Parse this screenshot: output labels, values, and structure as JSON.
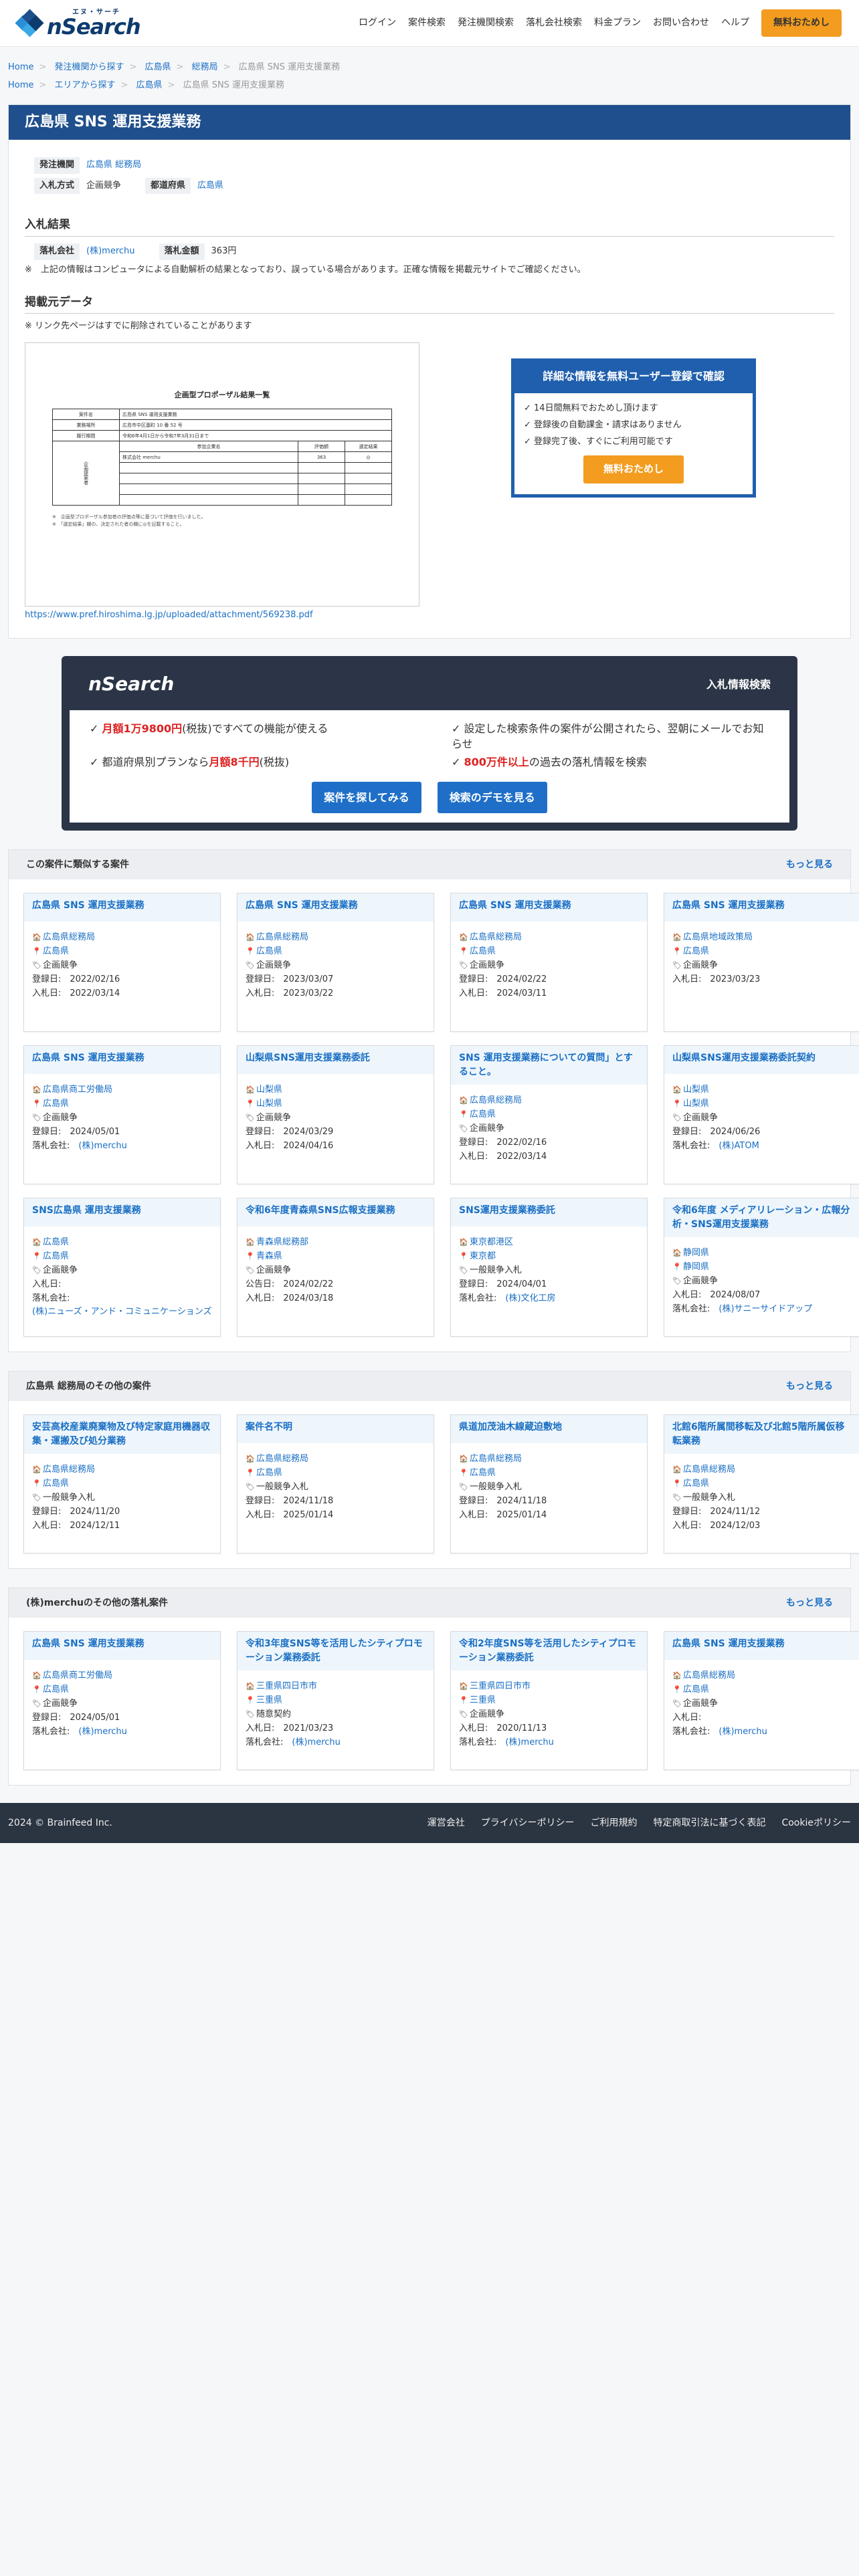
{
  "header": {
    "logo_ruby": "エヌ・サーチ",
    "logo_text": "nSearch",
    "nav": [
      "ログイン",
      "案件検索",
      "発注機関検索",
      "落札会社検索",
      "料金プラン",
      "お問い合わせ",
      "ヘルプ"
    ],
    "cta": "無料おためし"
  },
  "breadcrumb1": [
    "Home",
    "発注機関から探す",
    "広島県",
    "総務局",
    "広島県 SNS 運用支援業務"
  ],
  "breadcrumb2": [
    "Home",
    "エリアから探す",
    "広島県",
    "広島県 SNS 運用支援業務"
  ],
  "title": "広島県 SNS 運用支援業務",
  "meta": {
    "issuer_label": "発注機関",
    "issuer": "広島県 総務局",
    "pref_label": "都道府県",
    "pref": "広島県",
    "method_label": "入札方式",
    "method": "企画競争"
  },
  "result": {
    "heading": "入札結果",
    "winner_label": "落札会社",
    "winner": "(株)merchu",
    "amount_label": "落札金額",
    "amount": "363円",
    "note": "※　上記の情報はコンピュータによる自動解析の結果となっており、誤っている場合があります。正確な情報を掲載元サイトでご確認ください。"
  },
  "source": {
    "heading": "掲載元データ",
    "note": "※ リンク先ページはすでに削除されていることがあります",
    "url": "https://www.pref.hiroshima.lg.jp/uploaded/attachment/569238.pdf",
    "doc": {
      "title": "企画型プロポーザル結果一覧",
      "r1a": "案件名",
      "r1b": "広島県 SNS 運用支援業務",
      "r2a": "業務場所",
      "r2b": "広島市中区基町 10 番 52 号",
      "r3a": "履行期間",
      "r3b": "令和6年4月1日から令和7年3月31日まで",
      "h1": "参加企業名",
      "h2": "評価額",
      "h3": "選定結果",
      "c1": "株式会社 merchu",
      "c2": "363",
      "c3": "◎",
      "side": "企画提案者",
      "f1": "※　企画型プロポーザル参加者の評価点等に基づいて評価を行いました。",
      "f2": "※　「選定結果」欄の、決定された者の欄に◎を記載すること。"
    }
  },
  "cta_box": {
    "title": "詳細な情報を無料ユーザー登録で確認",
    "items": [
      "✓ 14日間無料でおためし頂けます",
      "✓ 登録後の自動課金・請求はありません",
      "✓ 登録完了後、すぐにご利用可能です"
    ],
    "button": "無料おためし"
  },
  "promo": {
    "logo": "nSearch",
    "title": "入札情報検索",
    "items": [
      {
        "pre": "✓ ",
        "red": "月額1万9800円",
        "post": "(税抜)ですべての機能が使える"
      },
      {
        "pre": "✓ 設定した検索条件の案件が公開されたら、翌朝にメールでお知らせ",
        "red": "",
        "post": ""
      },
      {
        "pre": "✓ 都道府県別プランなら",
        "red": "月額8千円",
        "post": "(税抜)"
      },
      {
        "pre": "✓ ",
        "red": "800万件以上",
        "post": "の過去の落札情報を検索"
      }
    ],
    "btn1": "案件を探してみる",
    "btn2": "検索のデモを見る"
  },
  "sections": [
    {
      "title": "この案件に類似する案件",
      "more": "もっと見る",
      "cards": [
        {
          "t": "広島県 SNS 運用支援業務",
          "lines": [
            [
              "🏠",
              "広島県総務局",
              1
            ],
            [
              "📍",
              "広島県",
              1
            ],
            [
              "🏷",
              "企画競争",
              0
            ],
            [
              "",
              "登録日:　2022/02/16",
              0
            ],
            [
              "",
              "入札日:　2022/03/14",
              0
            ]
          ]
        },
        {
          "t": "広島県 SNS 運用支援業務",
          "lines": [
            [
              "🏠",
              "広島県総務局",
              1
            ],
            [
              "📍",
              "広島県",
              1
            ],
            [
              "🏷",
              "企画競争",
              0
            ],
            [
              "",
              "登録日:　2023/03/07",
              0
            ],
            [
              "",
              "入札日:　2023/03/22",
              0
            ]
          ]
        },
        {
          "t": "広島県 SNS 運用支援業務",
          "lines": [
            [
              "🏠",
              "広島県総務局",
              1
            ],
            [
              "📍",
              "広島県",
              1
            ],
            [
              "🏷",
              "企画競争",
              0
            ],
            [
              "",
              "登録日:　2024/02/22",
              0
            ],
            [
              "",
              "入札日:　2024/03/11",
              0
            ]
          ]
        },
        {
          "t": "広島県 SNS 運用支援業務",
          "lines": [
            [
              "🏠",
              "広島県地域政策局",
              1
            ],
            [
              "📍",
              "広島県",
              1
            ],
            [
              "🏷",
              "企画競争",
              0
            ],
            [
              "",
              "入札日:　2023/03/23",
              0
            ]
          ]
        },
        {
          "t": "広島県 SNS 運用支援業務",
          "lines": [
            [
              "🏠",
              "広島県商工労働局",
              1
            ],
            [
              "📍",
              "広島県",
              1
            ],
            [
              "🏷",
              "企画競争",
              0
            ],
            [
              "",
              "登録日:　2024/05/01",
              0
            ],
            [
              "",
              "落札会社:　(株)merchu",
              2
            ]
          ]
        },
        {
          "t": "山梨県SNS運用支援業務委託",
          "lines": [
            [
              "🏠",
              "山梨県",
              1
            ],
            [
              "📍",
              "山梨県",
              1
            ],
            [
              "🏷",
              "企画競争",
              0
            ],
            [
              "",
              "登録日:　2024/03/29",
              0
            ],
            [
              "",
              "入札日:　2024/04/16",
              0
            ]
          ]
        },
        {
          "t": "SNS 運用支援業務についての質問」とすること。",
          "lines": [
            [
              "🏠",
              "広島県総務局",
              1
            ],
            [
              "📍",
              "広島県",
              1
            ],
            [
              "🏷",
              "企画競争",
              0
            ],
            [
              "",
              "登録日:　2022/02/16",
              0
            ],
            [
              "",
              "入札日:　2022/03/14",
              0
            ]
          ]
        },
        {
          "t": "山梨県SNS運用支援業務委託契約",
          "lines": [
            [
              "🏠",
              "山梨県",
              1
            ],
            [
              "📍",
              "山梨県",
              1
            ],
            [
              "🏷",
              "企画競争",
              0
            ],
            [
              "",
              "登録日:　2024/06/26",
              0
            ],
            [
              "",
              "落札会社:　(株)ATOM",
              2
            ]
          ]
        },
        {
          "t": "SNS広島県 運用支援業務",
          "lines": [
            [
              "🏠",
              "広島県",
              1
            ],
            [
              "📍",
              "広島県",
              1
            ],
            [
              "🏷",
              "企画競争",
              0
            ],
            [
              "",
              "入札日:",
              0
            ],
            [
              "",
              "落札会社:",
              0
            ],
            [
              "",
              "(株)ニューズ・アンド・コミュニケーションズ",
              1
            ]
          ]
        },
        {
          "t": "令和6年度青森県SNS広報支援業務",
          "lines": [
            [
              "🏠",
              "青森県総務部",
              1
            ],
            [
              "📍",
              "青森県",
              1
            ],
            [
              "🏷",
              "企画競争",
              0
            ],
            [
              "",
              "公告日:　2024/02/22",
              0
            ],
            [
              "",
              "入札日:　2024/03/18",
              0
            ]
          ]
        },
        {
          "t": "SNS運用支援業務委託",
          "lines": [
            [
              "🏠",
              "東京都港区",
              1
            ],
            [
              "📍",
              "東京都",
              1
            ],
            [
              "🏷",
              "一般競争入札",
              0
            ],
            [
              "",
              "登録日:　2024/04/01",
              0
            ],
            [
              "",
              "落札会社:　(株)文化工房",
              2
            ]
          ]
        },
        {
          "t": "令和6年度 メディアリレーション・広報分析・SNS運用支援業務",
          "lines": [
            [
              "🏠",
              "静岡県",
              1
            ],
            [
              "📍",
              "静岡県",
              1
            ],
            [
              "🏷",
              "企画競争",
              0
            ],
            [
              "",
              "入札日:　2024/08/07",
              0
            ],
            [
              "",
              "落札会社:　(株)サニーサイドアップ",
              2
            ]
          ]
        }
      ]
    },
    {
      "title": "広島県 総務局のその他の案件",
      "more": "もっと見る",
      "cards": [
        {
          "t": "安芸高校産業廃棄物及び特定家庭用機器収集・運搬及び処分業務",
          "lines": [
            [
              "🏠",
              "広島県総務局",
              1
            ],
            [
              "📍",
              "広島県",
              1
            ],
            [
              "🏷",
              "一般競争入札",
              0
            ],
            [
              "",
              "登録日:　2024/11/20",
              0
            ],
            [
              "",
              "入札日:　2024/12/11",
              0
            ]
          ]
        },
        {
          "t": "案件名不明",
          "lines": [
            [
              "🏠",
              "広島県総務局",
              1
            ],
            [
              "📍",
              "広島県",
              1
            ],
            [
              "🏷",
              "一般競争入札",
              0
            ],
            [
              "",
              "登録日:　2024/11/18",
              0
            ],
            [
              "",
              "入札日:　2025/01/14",
              0
            ]
          ]
        },
        {
          "t": "県道加茂油木線蔵迫敷地",
          "lines": [
            [
              "🏠",
              "広島県総務局",
              1
            ],
            [
              "📍",
              "広島県",
              1
            ],
            [
              "🏷",
              "一般競争入札",
              0
            ],
            [
              "",
              "登録日:　2024/11/18",
              0
            ],
            [
              "",
              "入札日:　2025/01/14",
              0
            ]
          ]
        },
        {
          "t": "北館6階所属間移転及び北館5階所属仮移転業務",
          "lines": [
            [
              "🏠",
              "広島県総務局",
              1
            ],
            [
              "📍",
              "広島県",
              1
            ],
            [
              "🏷",
              "一般競争入札",
              0
            ],
            [
              "",
              "登録日:　2024/11/12",
              0
            ],
            [
              "",
              "入札日:　2024/12/03",
              0
            ]
          ]
        }
      ]
    },
    {
      "title": "(株)merchuのその他の落札案件",
      "more": "もっと見る",
      "cards": [
        {
          "t": "広島県 SNS 運用支援業務",
          "lines": [
            [
              "🏠",
              "広島県商工労働局",
              1
            ],
            [
              "📍",
              "広島県",
              1
            ],
            [
              "🏷",
              "企画競争",
              0
            ],
            [
              "",
              "登録日:　2024/05/01",
              0
            ],
            [
              "",
              "落札会社:　(株)merchu",
              2
            ]
          ]
        },
        {
          "t": "令和3年度SNS等を活用したシティプロモーション業務委託",
          "lines": [
            [
              "🏠",
              "三重県四日市市",
              1
            ],
            [
              "📍",
              "三重県",
              1
            ],
            [
              "🏷",
              "随意契約",
              0
            ],
            [
              "",
              "入札日:　2021/03/23",
              0
            ],
            [
              "",
              "落札会社:　(株)merchu",
              2
            ]
          ]
        },
        {
          "t": "令和2年度SNS等を活用したシティプロモーション業務委託",
          "lines": [
            [
              "🏠",
              "三重県四日市市",
              1
            ],
            [
              "📍",
              "三重県",
              1
            ],
            [
              "🏷",
              "企画競争",
              0
            ],
            [
              "",
              "入札日:　2020/11/13",
              0
            ],
            [
              "",
              "落札会社:　(株)merchu",
              2
            ]
          ]
        },
        {
          "t": "広島県 SNS 運用支援業務",
          "lines": [
            [
              "🏠",
              "広島県総務局",
              1
            ],
            [
              "📍",
              "広島県",
              1
            ],
            [
              "🏷",
              "企画競争",
              0
            ],
            [
              "",
              "入札日:",
              0
            ],
            [
              "",
              "落札会社:　(株)merchu",
              2
            ]
          ]
        }
      ]
    }
  ],
  "footer": {
    "copy": "2024 © Brainfeed Inc.",
    "links": [
      "運営会社",
      "プライバシーポリシー",
      "ご利用規約",
      "特定商取引法に基づく表記",
      "Cookieポリシー"
    ]
  },
  "colors": {
    "brand": "#1f4f8c",
    "accent": "#f39c1f",
    "link": "#1a6fc4",
    "dark": "#2b3547"
  }
}
